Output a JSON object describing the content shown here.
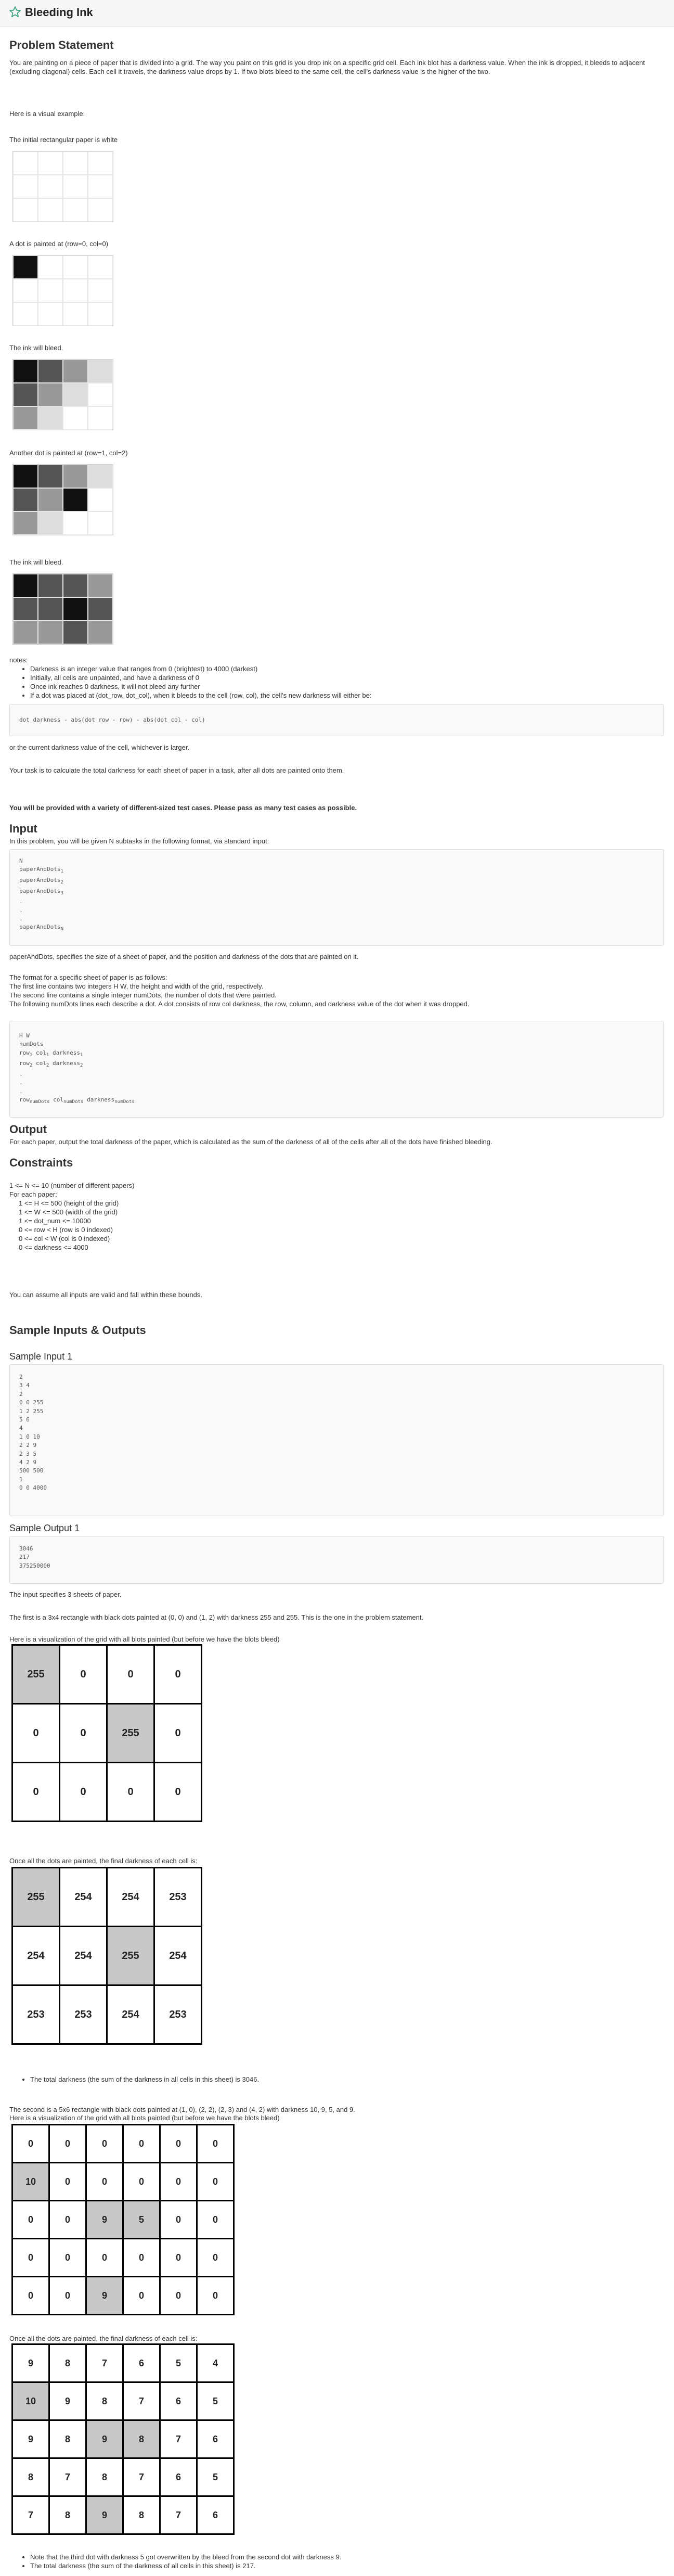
{
  "app": {
    "title": "Bleeding Ink"
  },
  "problem": {
    "heading": "Problem Statement",
    "intro": "You are painting on a piece of paper that is divided into a grid. The way you paint on this grid is you drop ink on a specific grid cell. Each ink blot has a darkness value. When the ink is dropped, it bleeds to adjacent (excluding diagonal) cells. Each cell it travels, the darkness value drops by 1. If two blots bleed to the same cell, the cell's darkness value is the higher of the two.",
    "visual_intro": "Here is a visual example:",
    "cap1": "The initial rectangular paper is white",
    "cap2": "A dot is painted at (row=0, col=0)",
    "cap3": "The ink will bleed.",
    "cap4": "Another dot is painted at (row=1, col=2)",
    "cap5": "The ink will bleed.",
    "notes_label": "notes:",
    "notes": [
      "Darkness is an integer value that ranges from 0 (brightest) to 4000 (darkest)",
      "Initially, all cells are unpainted, and have a darkness of 0",
      "Once ink reaches 0 darkness, it will not bleed any further",
      "If a dot was placed at (dot_row, dot_col), when it bleeds to the cell (row, col), the cell's new darkness will either be:"
    ],
    "formula": "dot_darkness - abs(dot_row - row) - abs(dot_col - col)",
    "or_text": "or the current darkness value of the cell, whichever is larger.",
    "task": "Your task is to calculate the total darkness for each sheet of paper in a task, after all dots are painted onto them.",
    "warning": "You will be provided with a variety of different-sized test cases. Please pass as many test cases as possible."
  },
  "input": {
    "heading": "Input",
    "text": "In this problem, you will be given N subtasks in the following format, via standard input:",
    "paper_desc": "paperAndDots, specifies the size of a sheet of paper, and the position and darkness of the dots that are painted on it.",
    "format_lines": [
      "The format for a specific sheet of paper is as follows:",
      "The first line contains two integers H W, the height and width of the grid, respectively.",
      "The second line contains a single integer numDots, the number of dots that were painted.",
      "The following numDots lines each describe a dot. A dot consists of row col darkness, the row, column, and darkness value of the dot when it was dropped."
    ]
  },
  "output": {
    "heading": "Output",
    "text": "For each paper, output the total darkness of the paper, which is calculated as the sum of the darkness of all of the cells after all of the dots have finished bleeding."
  },
  "constraints": {
    "heading": "Constraints",
    "lines": [
      "1 <= N <= 10 (number of different papers)",
      "For each paper:",
      "1 <= H <= 500 (height of the grid)",
      "1 <= W <= 500 (width of the grid)",
      "1 <= dot_num <= 10000",
      "0 <= row < H (row is 0 indexed)",
      "0 <= col < W (col is 0 indexed)",
      "0 <= darkness <= 4000"
    ],
    "assume": "You can assume all inputs are valid and fall within these bounds."
  },
  "samples": {
    "heading": "Sample Inputs & Outputs",
    "input_heading": "Sample Input 1",
    "input_text": "2\n3 4\n2\n0 0 255\n1 2 255\n5 6\n4\n1 0 10\n2 2 9\n2 3 5\n4 2 9\n500 500\n1\n0 0 4000",
    "output_heading": "Sample Output 1",
    "output_text": "3046\n217\n375250000",
    "explain": "The input specifies 3 sheets of paper.",
    "first_desc": "The first is a 3x4 rectangle with black dots painted at (0, 0) and (1, 2) with darkness 255 and 255. This is the one in the problem statement.",
    "vis_before_1": "Here is a visualization of the grid with all blots painted (but before we have the blots bleed)",
    "grid1_before": [
      [
        "255",
        "0",
        "0",
        "0"
      ],
      [
        "0",
        "0",
        "255",
        "0"
      ],
      [
        "0",
        "0",
        "0",
        "0"
      ]
    ],
    "final_label_1": "Once all the dots are painted, the final darkness of each cell is:",
    "grid1_after": [
      [
        "255",
        "254",
        "254",
        "253"
      ],
      [
        "254",
        "254",
        "255",
        "254"
      ],
      [
        "253",
        "253",
        "254",
        "253"
      ]
    ],
    "total1": "The total darkness (the sum of the darkness in all cells in this sheet) is 3046.",
    "second_desc": "The second is a 5x6 rectangle with black dots painted at (1, 0), (2, 2), (2, 3) and (4, 2) with darkness 10, 9, 5, and 9.",
    "vis_before_2": "Here is a visualization of the grid with all blots painted (but before we have the blots bleed)",
    "grid2_before": [
      [
        "0",
        "0",
        "0",
        "0",
        "0",
        "0"
      ],
      [
        "10",
        "0",
        "0",
        "0",
        "0",
        "0"
      ],
      [
        "0",
        "0",
        "9",
        "5",
        "0",
        "0"
      ],
      [
        "0",
        "0",
        "0",
        "0",
        "0",
        "0"
      ],
      [
        "0",
        "0",
        "9",
        "0",
        "0",
        "0"
      ]
    ],
    "final_label_2": "Once all the dots are painted, the final darkness of each cell is:",
    "grid2_after": [
      [
        "9",
        "8",
        "7",
        "6",
        "5",
        "4"
      ],
      [
        "10",
        "9",
        "8",
        "7",
        "6",
        "5"
      ],
      [
        "9",
        "8",
        "9",
        "8",
        "7",
        "6"
      ],
      [
        "8",
        "7",
        "8",
        "7",
        "6",
        "5"
      ],
      [
        "7",
        "8",
        "9",
        "8",
        "7",
        "6"
      ]
    ],
    "note3": "Note that the third dot with darkness 5 got overwritten by the bleed from the second dot with darkness 9.",
    "total2": "The total darkness (the sum of the darkness of all cells in this sheet) is 217."
  },
  "icons": {
    "title_icon": "star-icon"
  },
  "colors": {
    "painted_cell": "#c8c8c8",
    "ink_dark": "#111111"
  }
}
